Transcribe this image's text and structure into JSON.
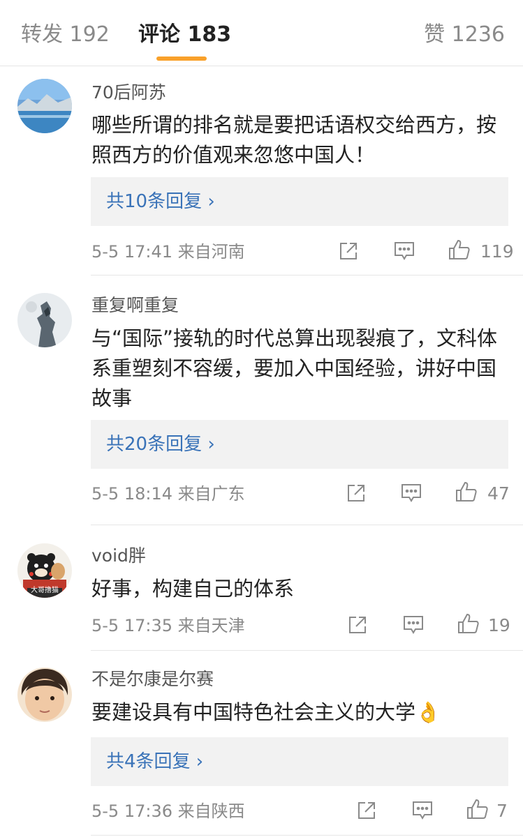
{
  "tabs": {
    "repost": "转发 192",
    "comments": "评论 183",
    "likes": "赞 1236"
  },
  "comments": [
    {
      "username": "70后阿苏",
      "text": "哪些所谓的排名就是要把话语权交给西方，按照西方的价值观来忽悠中国人！",
      "replies": "共10条回复 ›",
      "meta": "5-5 17:41  来自河南",
      "likes": "119"
    },
    {
      "username": "重复啊重复",
      "text": "与“国际”接轨的时代总算出现裂痕了，文科体系重塑刻不容缓，要加入中国经验，讲好中国故事",
      "replies": "共20条回复 ›",
      "meta": "5-5 18:14  来自广东",
      "likes": "47"
    },
    {
      "username": "void胖",
      "text": "好事，构建自己的体系",
      "meta": "5-5 17:35  来自天津",
      "likes": "19",
      "avatar_caption": "大哥撸猫"
    },
    {
      "username": "不是尔康是尔赛",
      "text": "要建设具有中国特色社会主义的大学👌",
      "replies": "共4条回复 ›",
      "meta": "5-5 17:36  来自陕西",
      "likes": "7"
    }
  ],
  "colors": {
    "accent": "#f9a12a",
    "link": "#3a73b8",
    "muted": "#8a8a8a"
  },
  "icons": [
    "share-icon",
    "comment-icon",
    "thumbs-up-icon"
  ]
}
